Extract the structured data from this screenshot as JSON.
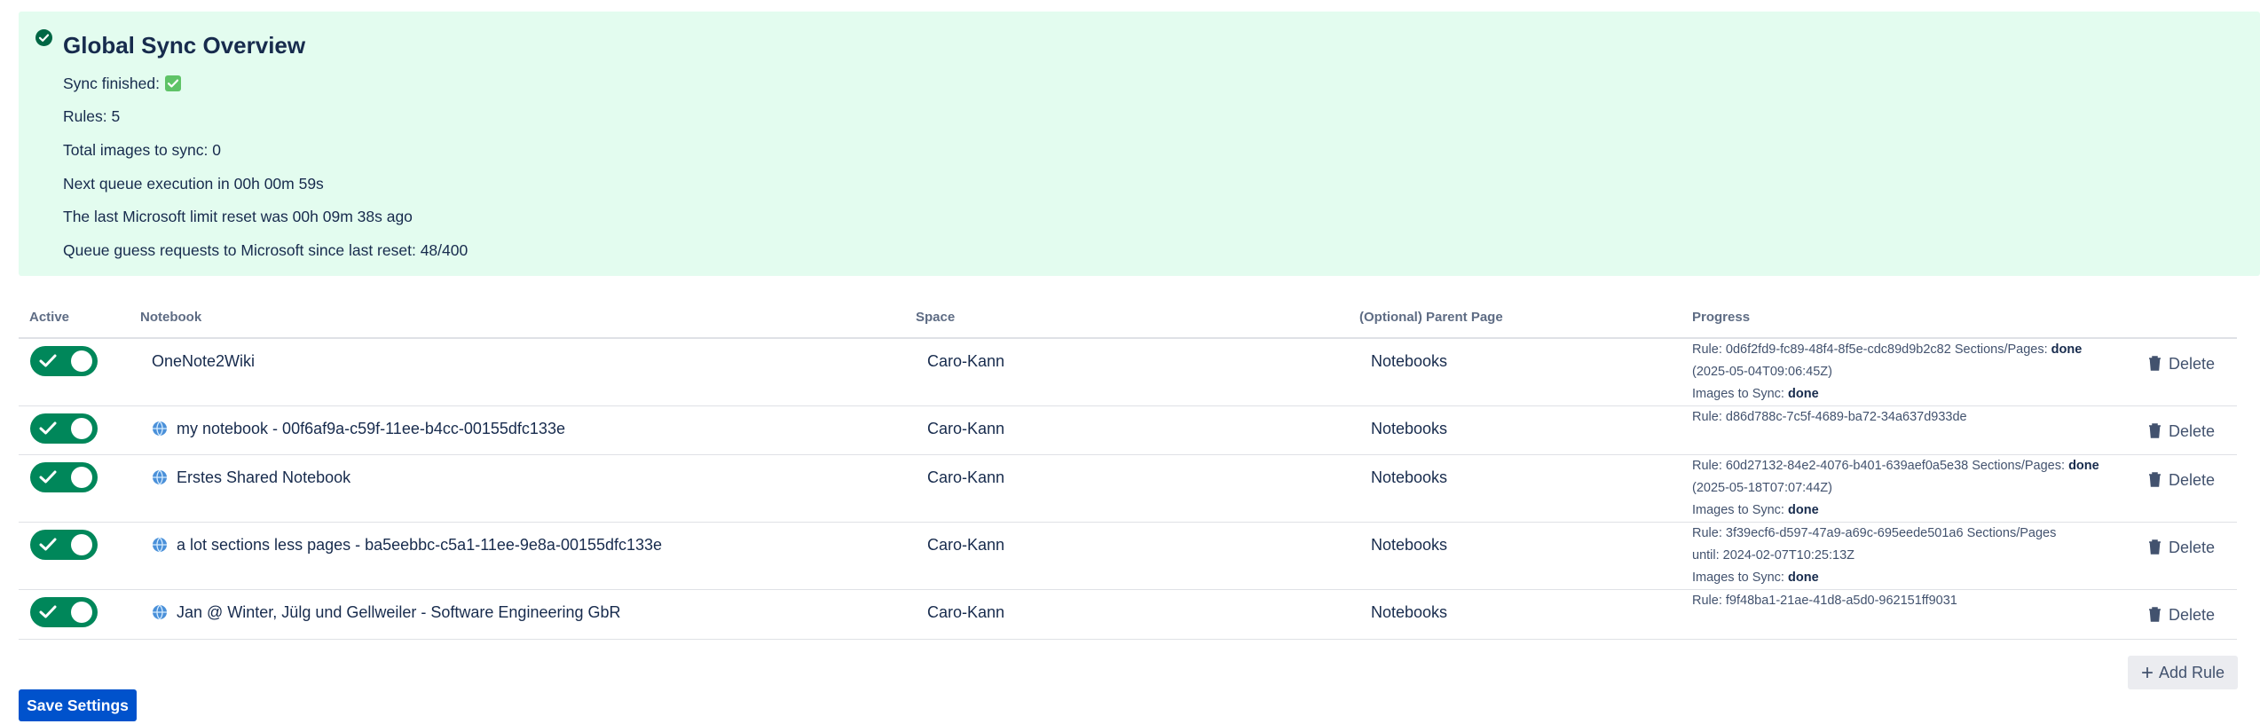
{
  "overview": {
    "title": "Global Sync Overview",
    "sync_finished_label": "Sync finished:",
    "rules_count": "Rules: 5",
    "total_images": "Total images to sync: 0",
    "next_queue": "Next queue execution in 00h 00m 59s",
    "last_reset": "The last Microsoft limit reset was 00h 09m 38s ago",
    "queue_requests": "Queue guess requests to Microsoft since last reset: 48/400"
  },
  "table": {
    "columns": [
      "Active",
      "Notebook",
      "Space",
      "(Optional) Parent Page",
      "Progress"
    ],
    "delete_label": "Delete",
    "rows": [
      {
        "notebook": "OneNote2Wiki",
        "space": "Caro-Kann",
        "parent": "Notebooks",
        "progress": [
          {
            "text": "Rule: 0d6f2fd9-fc89-48f4-8f5e-cdc89d9b2c82 Sections/Pages: ",
            "bold": "done"
          },
          {
            "text": "(2025-05-04T09:06:45Z)",
            "bold": ""
          },
          {
            "text": "Images to Sync: ",
            "bold": "done"
          }
        ]
      },
      {
        "notebook": "my notebook - 00f6af9a-c59f-11ee-b4cc-00155dfc133e",
        "space": "Caro-Kann",
        "parent": "Notebooks",
        "progress": [
          {
            "text": "Rule: d86d788c-7c5f-4689-ba72-34a637d933de",
            "bold": ""
          }
        ]
      },
      {
        "notebook": "Erstes Shared Notebook",
        "space": "Caro-Kann",
        "parent": "Notebooks",
        "progress": [
          {
            "text": "Rule: 60d27132-84e2-4076-b401-639aef0a5e38 Sections/Pages: ",
            "bold": "done"
          },
          {
            "text": "(2025-05-18T07:07:44Z)",
            "bold": ""
          },
          {
            "text": "Images to Sync: ",
            "bold": "done"
          }
        ]
      },
      {
        "notebook": "a lot sections less pages - ba5eebbc-c5a1-11ee-9e8a-00155dfc133e",
        "space": "Caro-Kann",
        "parent": "Notebooks",
        "progress": [
          {
            "text": "Rule: 3f39ecf6-d597-47a9-a69c-695eede501a6 Sections/Pages",
            "bold": ""
          },
          {
            "text": "until: 2024-02-07T10:25:13Z",
            "bold": ""
          },
          {
            "text": "Images to Sync: ",
            "bold": "done"
          }
        ]
      },
      {
        "notebook": "Jan @ Winter, Jülg und Gellweiler - Software Engineering GbR",
        "space": "Caro-Kann",
        "parent": "Notebooks",
        "progress": [
          {
            "text": "Rule: f9f48ba1-21ae-41d8-a5d0-962151ff9031",
            "bold": ""
          }
        ]
      }
    ]
  },
  "buttons": {
    "add_rule": "Add Rule",
    "save_settings": "Save Settings"
  },
  "colors": {
    "success_bg": "#e3fcef",
    "toggle_on": "#00875a",
    "primary": "#0052cc"
  }
}
